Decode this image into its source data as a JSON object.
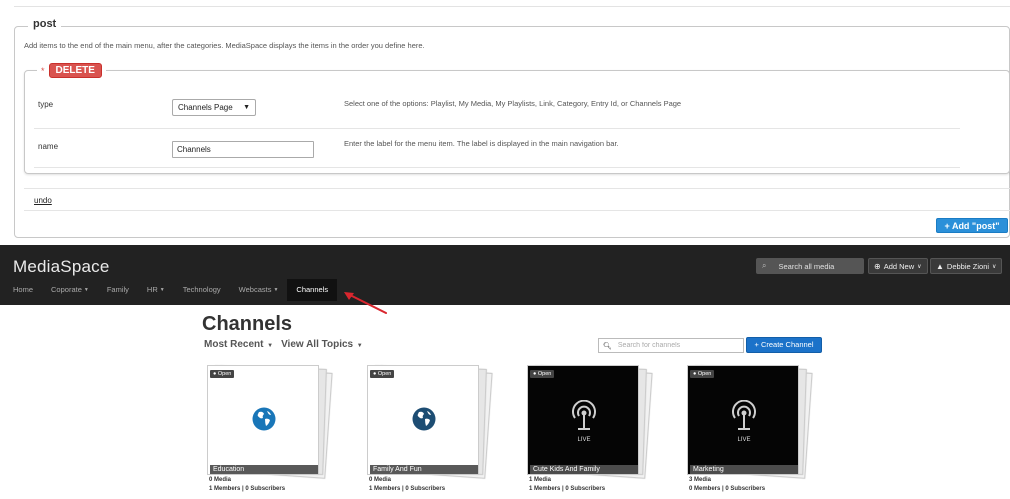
{
  "admin": {
    "section_title": "post",
    "description": "Add items to the end of the main menu, after the categories. MediaSpace displays the items in the order you define here.",
    "item": {
      "required_mark": "*",
      "delete_label": "DELETE",
      "type_label": "type",
      "type_value": "Channels Page",
      "type_help": "Select one of the options: Playlist, My Media, My Playlists, Link, Category, Entry Id, or Channels Page",
      "name_label": "name",
      "name_value": "Channels",
      "name_help": "Enter the label for the menu item. The label is displayed in the main navigation bar."
    },
    "undo_label": "undo",
    "add_label": "+ Add \"post\""
  },
  "header": {
    "brand": "MediaSpace",
    "search_placeholder": "Search all media",
    "add_new_label": "Add New",
    "user_label": "Debbie Zioni",
    "nav": [
      {
        "label": "Home"
      },
      {
        "label": "Coporate"
      },
      {
        "label": "Family"
      },
      {
        "label": "HR"
      },
      {
        "label": "Technology"
      },
      {
        "label": "Webcasts"
      },
      {
        "label": "Channels"
      }
    ]
  },
  "channels_page": {
    "title": "Channels",
    "filter_sort": "Most Recent",
    "filter_topics": "View All Topics",
    "search_placeholder": "Search for channels",
    "create_label": "+ Create Channel",
    "cards": [
      {
        "badge": "Open",
        "name": "Education",
        "media": "0 Media",
        "members": "1 Members | 0 Subscribers",
        "thumb": "globe-icon"
      },
      {
        "badge": "Open",
        "name": "Family And Fun",
        "media": "0 Media",
        "members": "1 Members | 0 Subscribers",
        "thumb": "globe-icon"
      },
      {
        "badge": "Open",
        "name": "Cute Kids And Family",
        "media": "1 Media",
        "members": "1 Members | 0 Subscribers",
        "thumb": "live-broadcast-icon",
        "live_text": "LIVE"
      },
      {
        "badge": "Open",
        "name": "Marketing",
        "media": "3 Media",
        "members": "0 Members | 0 Subscribers",
        "thumb": "live-broadcast-icon",
        "live_text": "LIVE"
      }
    ]
  },
  "colors": {
    "delete_red": "#d9534f",
    "add_blue": "#2b90d9",
    "header_bg": "#222222",
    "create_blue": "#1b72c9",
    "globe_blue": "#1976b8",
    "arrow_red": "#d9262e"
  }
}
